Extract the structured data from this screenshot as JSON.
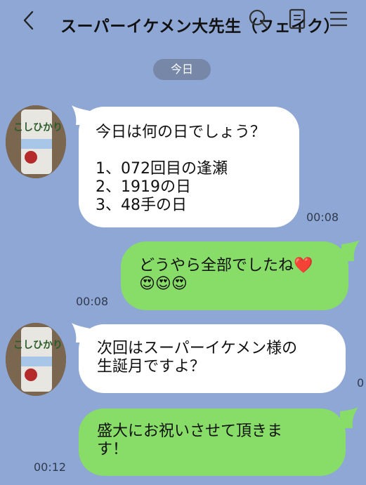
{
  "header": {
    "title": "スーパーイケメン大先生（フェイク）"
  },
  "date_label": "今日",
  "messages": [
    {
      "side": "in",
      "text": "今日は何の日でしょう？\n\n1、072回目の逢瀬\n2、1919の日\n3、48手の日",
      "time": "00:08"
    },
    {
      "side": "out",
      "text": "どうやら全部でしたね❤️\n😍😍😍",
      "time": "00:08"
    },
    {
      "side": "in",
      "text": "次回はスーパーイケメン様の\n生誕月ですよ？",
      "time": ""
    },
    {
      "side": "out",
      "text": "盛大にお祝いさせて頂きま\nす！",
      "time": "00:12"
    }
  ],
  "cut_off_char": "0",
  "avatar": {
    "label": "こしひかり"
  },
  "colors": {
    "background": "#8fa7d4",
    "incoming": "#ffffff",
    "outgoing": "#87dd67",
    "pill": "#7687a8"
  }
}
